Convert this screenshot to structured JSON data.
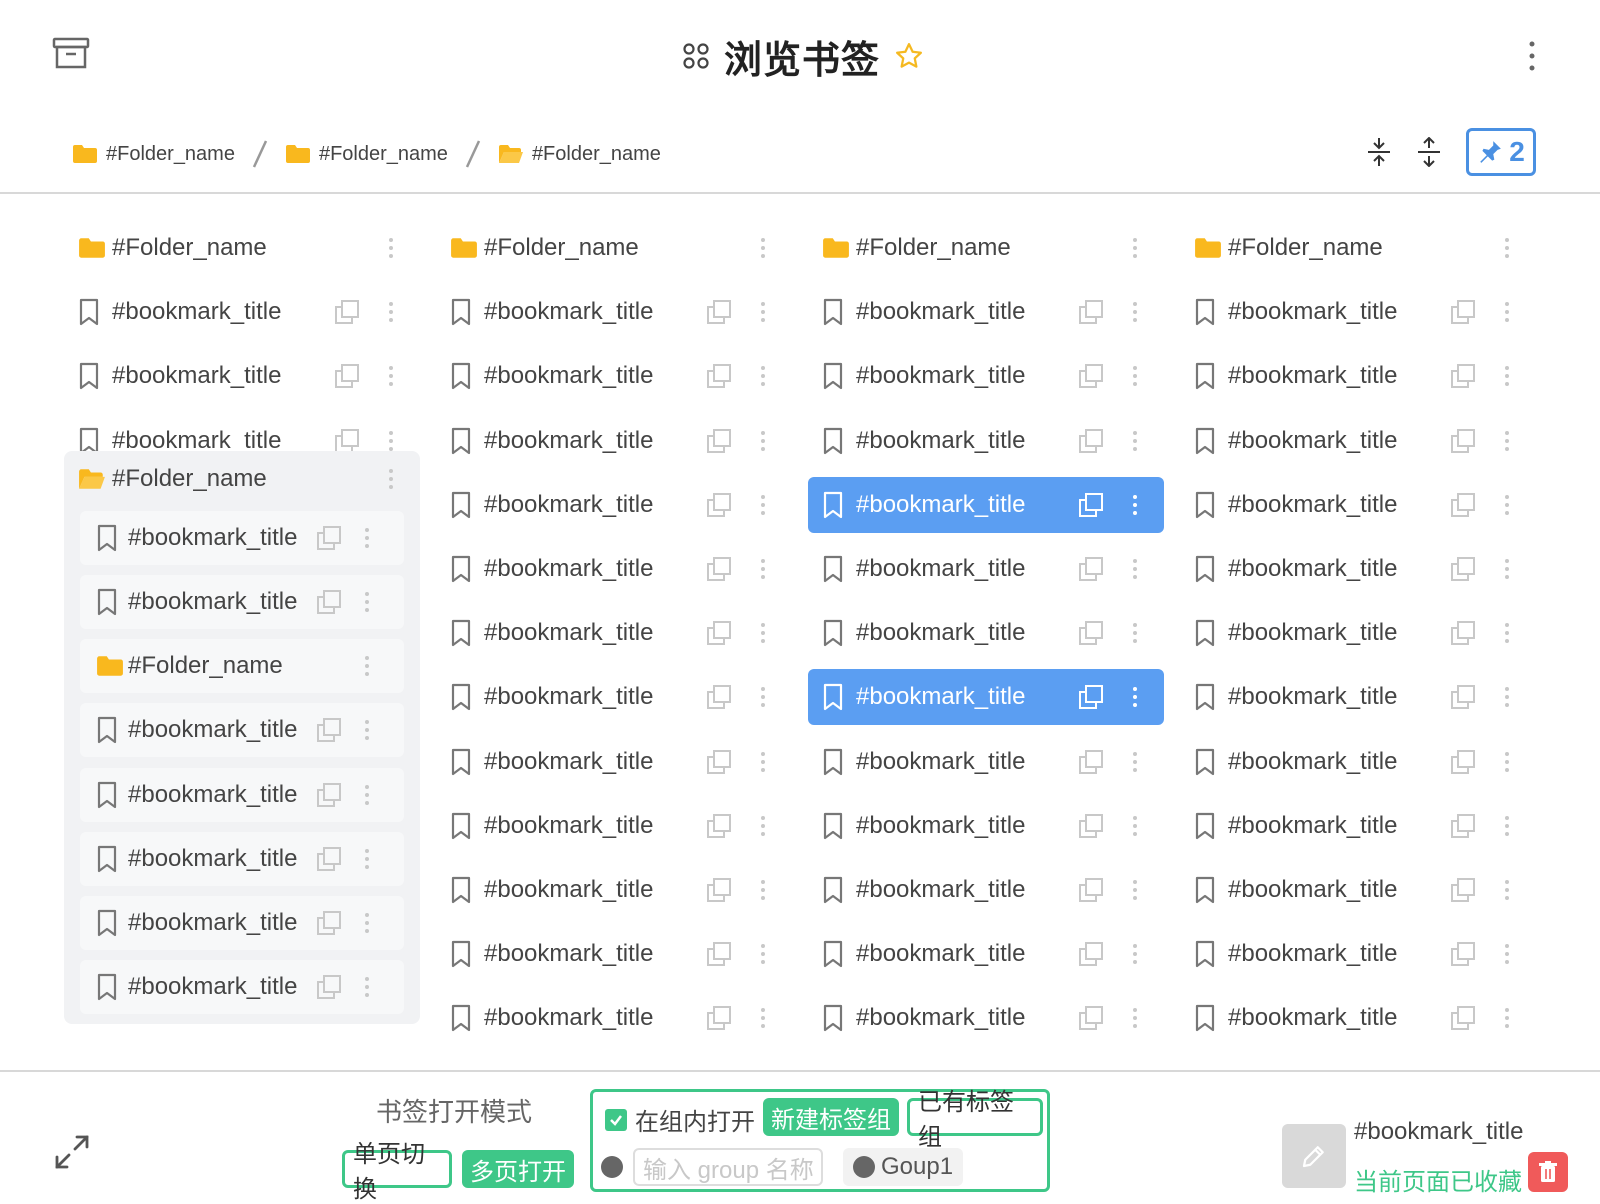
{
  "header": {
    "title": "浏览书签",
    "icons": [
      "archive-icon",
      "apps-icon",
      "star-icon",
      "more-vertical-icon"
    ]
  },
  "breadcrumb": [
    {
      "label": "#Folder_name"
    },
    {
      "label": "#Folder_name"
    },
    {
      "label": "#Folder_name"
    }
  ],
  "toolbar": {
    "pin_count": "2",
    "icons": [
      "collapse-vertical-icon",
      "expand-vertical-icon",
      "pin-icon"
    ]
  },
  "columns": [
    {
      "items": [
        {
          "type": "folder",
          "label": "#Folder_name"
        },
        {
          "type": "bookmark",
          "label": "#bookmark_title"
        },
        {
          "type": "bookmark",
          "label": "#bookmark_title"
        },
        {
          "type": "bookmark",
          "label": "#bookmark_title"
        }
      ],
      "group": {
        "label": "#Folder_name",
        "items": [
          {
            "type": "bookmark",
            "label": "#bookmark_title"
          },
          {
            "type": "bookmark",
            "label": "#bookmark_title"
          },
          {
            "type": "folder",
            "label": "#Folder_name"
          },
          {
            "type": "bookmark",
            "label": "#bookmark_title"
          },
          {
            "type": "bookmark",
            "label": "#bookmark_title"
          },
          {
            "type": "bookmark",
            "label": "#bookmark_title"
          },
          {
            "type": "bookmark",
            "label": "#bookmark_title"
          },
          {
            "type": "bookmark",
            "label": "#bookmark_title"
          }
        ]
      }
    },
    {
      "items": [
        {
          "type": "folder",
          "label": "#Folder_name"
        },
        {
          "type": "bookmark",
          "label": "#bookmark_title"
        },
        {
          "type": "bookmark",
          "label": "#bookmark_title"
        },
        {
          "type": "bookmark",
          "label": "#bookmark_title"
        },
        {
          "type": "bookmark",
          "label": "#bookmark_title"
        },
        {
          "type": "bookmark",
          "label": "#bookmark_title"
        },
        {
          "type": "bookmark",
          "label": "#bookmark_title"
        },
        {
          "type": "bookmark",
          "label": "#bookmark_title"
        },
        {
          "type": "bookmark",
          "label": "#bookmark_title"
        },
        {
          "type": "bookmark",
          "label": "#bookmark_title"
        },
        {
          "type": "bookmark",
          "label": "#bookmark_title"
        },
        {
          "type": "bookmark",
          "label": "#bookmark_title"
        },
        {
          "type": "bookmark",
          "label": "#bookmark_title"
        }
      ]
    },
    {
      "items": [
        {
          "type": "folder",
          "label": "#Folder_name"
        },
        {
          "type": "bookmark",
          "label": "#bookmark_title"
        },
        {
          "type": "bookmark",
          "label": "#bookmark_title"
        },
        {
          "type": "bookmark",
          "label": "#bookmark_title"
        },
        {
          "type": "bookmark",
          "label": "#bookmark_title",
          "selected": true
        },
        {
          "type": "bookmark",
          "label": "#bookmark_title"
        },
        {
          "type": "bookmark",
          "label": "#bookmark_title"
        },
        {
          "type": "bookmark",
          "label": "#bookmark_title",
          "selected": true
        },
        {
          "type": "bookmark",
          "label": "#bookmark_title"
        },
        {
          "type": "bookmark",
          "label": "#bookmark_title"
        },
        {
          "type": "bookmark",
          "label": "#bookmark_title"
        },
        {
          "type": "bookmark",
          "label": "#bookmark_title"
        },
        {
          "type": "bookmark",
          "label": "#bookmark_title"
        }
      ]
    },
    {
      "items": [
        {
          "type": "folder",
          "label": "#Folder_name"
        },
        {
          "type": "bookmark",
          "label": "#bookmark_title"
        },
        {
          "type": "bookmark",
          "label": "#bookmark_title"
        },
        {
          "type": "bookmark",
          "label": "#bookmark_title"
        },
        {
          "type": "bookmark",
          "label": "#bookmark_title"
        },
        {
          "type": "bookmark",
          "label": "#bookmark_title"
        },
        {
          "type": "bookmark",
          "label": "#bookmark_title"
        },
        {
          "type": "bookmark",
          "label": "#bookmark_title"
        },
        {
          "type": "bookmark",
          "label": "#bookmark_title"
        },
        {
          "type": "bookmark",
          "label": "#bookmark_title"
        },
        {
          "type": "bookmark",
          "label": "#bookmark_title"
        },
        {
          "type": "bookmark",
          "label": "#bookmark_title"
        },
        {
          "type": "bookmark",
          "label": "#bookmark_title"
        }
      ]
    }
  ],
  "footer": {
    "mode_label": "书签打开模式",
    "single_page_label": "单页切换",
    "multi_page_label": "多页打开",
    "in_group_label": "在组内打开",
    "new_group_label": "新建标签组",
    "existing_group_label": "已有标签组",
    "group_input_placeholder": "输入 group 名称",
    "existing_group_name": "Goup1",
    "bookmark_title": "#bookmark_title",
    "saved_status": "当前页面已收藏"
  },
  "colors": {
    "accent_blue": "#5b9ef2",
    "pin_blue": "#4a90e2",
    "green": "#3ec788",
    "folder_yellow": "#f9b81e",
    "delete_red": "#f05a5a"
  }
}
